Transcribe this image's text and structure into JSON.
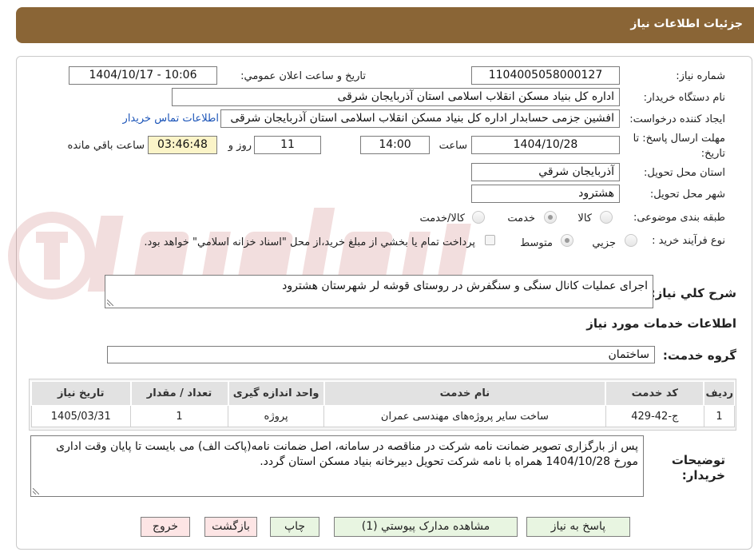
{
  "header": {
    "title": "جزئيات اطلاعات نياز"
  },
  "fields": {
    "need_number_label": "شماره نياز:",
    "need_number": "1104005058000127",
    "announce_label": "تاريخ و ساعت اعلان عمومي:",
    "announce_value": "1404/10/17 - 10:06",
    "buyer_org_label": "نام دستگاه خريدار:",
    "buyer_org": "اداره کل بنیاد مسکن انقلاب اسلامی استان آذربایجان شرقی",
    "requester_label": "ايجاد کننده درخواست:",
    "requester": "افشین جزمی حسابدار اداره کل بنیاد مسکن انقلاب اسلامی استان آذربایجان شرقی",
    "contact_link": "اطلاعات تماس خريدار",
    "deadline_label_1": "مهلت ارسال پاسخ: تا",
    "deadline_label_2": "تاريخ:",
    "deadline_date": "1404/10/28",
    "time_label": "ساعت",
    "deadline_time": "14:00",
    "days_value": "11",
    "days_label": "روز و",
    "remaining_time": "03:46:48",
    "remaining_label": "ساعت باقي مانده",
    "province_label": "استان محل تحويل:",
    "province": "آذربايجان شرقي",
    "city_label": "شهر محل تحويل:",
    "city": "هشترود",
    "category_label": "طبقه بندی موضوعی:",
    "category_options": [
      "کالا",
      "خدمت",
      "کالا/خدمت"
    ],
    "category_selected": "خدمت",
    "process_label": "نوع فرآيند خريد :",
    "process_options": [
      "جزيي",
      "متوسط"
    ],
    "process_selected": "متوسط",
    "payment_note": "پرداخت تمام يا بخشي از مبلغ خريد،از محل \"اسناد خزانه اسلامي\" خواهد بود."
  },
  "description": {
    "label": "شرح کلي نياز:",
    "value": "اجرای عملیات کانال سنگی و سنگفرش در روستای قوشه لر شهرستان  هشترود"
  },
  "services": {
    "section_title": "اطلاعات خدمات مورد نياز",
    "group_label": "گروه خدمت:",
    "group_value": "ساختمان",
    "columns": [
      "رديف",
      "کد خدمت",
      "نام خدمت",
      "واحد اندازه گيری",
      "تعداد / مقدار",
      "تاريخ نياز"
    ],
    "rows": [
      [
        "1",
        "ج-42-429",
        "ساخت سایر پروژه‌های مهندسی عمران",
        "پروژه",
        "1",
        "1405/03/31"
      ]
    ]
  },
  "buyer_notes": {
    "label_1": "توضيحات",
    "label_2": "خريدار:",
    "value": "پس از بارگزاری تصویر ضمانت نامه شرکت در مناقصه در سامانه، اصل ضمانت نامه(پاکت الف) می بایست تا پایان وقت اداری مورخ 1404/10/28 همراه با نامه شرکت تحویل دبیرخانه بنیاد مسکن استان گردد."
  },
  "buttons": {
    "reply": "پاسخ به نياز",
    "attachments": "مشاهده مدارک پيوستي (1)",
    "print": "چاپ",
    "back": "بازگشت",
    "exit": "خروج"
  },
  "colors": {
    "header_bg": "#8a6536",
    "remaining_bg": "#fbf4c8",
    "link": "#1b54b8"
  }
}
